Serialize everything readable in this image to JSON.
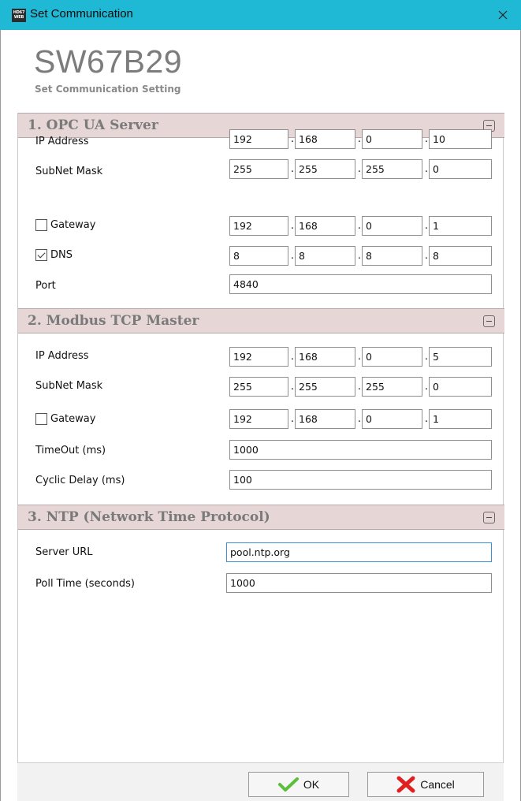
{
  "window": {
    "app_icon_text": "HD67 WEB",
    "title": "Set Communication"
  },
  "product": {
    "name": "SW67B29",
    "subtitle": "Set Communication Setting"
  },
  "sections": {
    "opc": {
      "title": "1. OPC UA Server",
      "ip_label": "IP Address",
      "ip": [
        "192",
        "168",
        "0",
        "10"
      ],
      "mask_label": "SubNet Mask",
      "mask": [
        "255",
        "255",
        "255",
        "0"
      ],
      "gateway_label": "Gateway",
      "gateway_checked": false,
      "gateway": [
        "192",
        "168",
        "0",
        "1"
      ],
      "dns_label": "DNS",
      "dns_checked": true,
      "dns": [
        "8",
        "8",
        "8",
        "8"
      ],
      "port_label": "Port",
      "port": "4840"
    },
    "modbus": {
      "title": "2. Modbus TCP Master",
      "ip_label": "IP Address",
      "ip": [
        "192",
        "168",
        "0",
        "5"
      ],
      "mask_label": "SubNet Mask",
      "mask": [
        "255",
        "255",
        "255",
        "0"
      ],
      "gateway_label": "Gateway",
      "gateway_checked": false,
      "gateway": [
        "192",
        "168",
        "0",
        "1"
      ],
      "timeout_label": "TimeOut (ms)",
      "timeout": "1000",
      "delay_label": "Cyclic Delay (ms)",
      "delay": "100"
    },
    "ntp": {
      "title": "3. NTP (Network Time Protocol)",
      "url_label": "Server URL",
      "url": "pool.ntp.org",
      "poll_label": "Poll Time (seconds)",
      "poll": "1000"
    }
  },
  "footer": {
    "ok_label": "OK",
    "cancel_label": "Cancel"
  },
  "icons": {
    "close": "close-icon",
    "collapse": "collapse-icon",
    "ok": "checkmark-icon",
    "cancel": "red-x-icon"
  },
  "colors": {
    "titlebar": "#1fb9d6",
    "section_header": "#e6d6d6",
    "ok_check": "#5bbf3a",
    "cancel_x": "#e02020"
  }
}
